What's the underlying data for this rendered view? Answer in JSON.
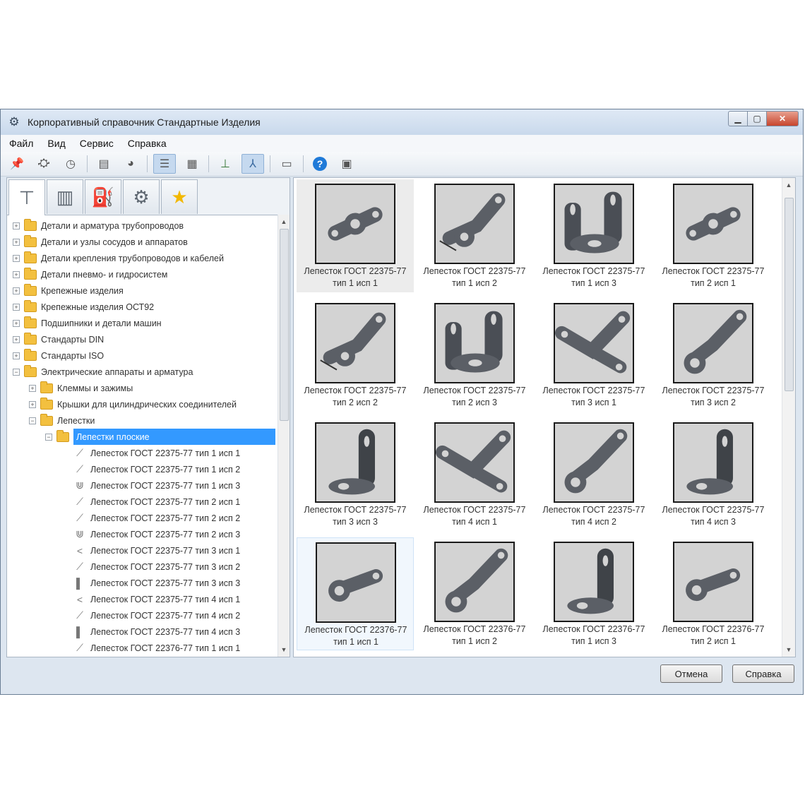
{
  "window": {
    "title": "Корпоративный справочник Стандартные Изделия"
  },
  "menu": [
    "Файл",
    "Вид",
    "Сервис",
    "Справка"
  ],
  "tree": {
    "folders": [
      "Детали и арматура трубопроводов",
      "Детали и узлы сосудов и аппаратов",
      "Детали крепления трубопроводов и кабелей",
      "Детали пневмо- и гидросистем",
      "Крепежные изделия",
      "Крепежные изделия ОСТ92",
      "Подшипники и детали машин",
      "Стандарты DIN",
      "Стандарты ISO",
      "Электрические аппараты и арматура"
    ],
    "sub_folders": [
      "Клеммы и зажимы",
      "Крышки для цилиндрических соединителей",
      "Лепестки"
    ],
    "selected_folder": "Лепестки плоские",
    "leaves": [
      "Лепесток ГОСТ 22375-77 тип 1 исп 1",
      "Лепесток ГОСТ 22375-77 тип 1 исп 2",
      "Лепесток ГОСТ 22375-77 тип 1 исп 3",
      "Лепесток ГОСТ 22375-77 тип 2 исп 1",
      "Лепесток ГОСТ 22375-77 тип 2 исп 2",
      "Лепесток ГОСТ 22375-77 тип 2 исп 3",
      "Лепесток ГОСТ 22375-77 тип 3 исп 1",
      "Лепесток ГОСТ 22375-77 тип 3 исп 2",
      "Лепесток ГОСТ 22375-77 тип 3 исп 3",
      "Лепесток ГОСТ 22375-77 тип 4 исп 1",
      "Лепесток ГОСТ 22375-77 тип 4 исп 2",
      "Лепесток ГОСТ 22375-77 тип 4 исп 3",
      "Лепесток ГОСТ 22376-77 тип 1 исп 1"
    ]
  },
  "grid": [
    {
      "line1": "Лепесток ГОСТ 22375-77",
      "line2": "тип 1 исп 1",
      "shape": "flat"
    },
    {
      "line1": "Лепесток ГОСТ 22375-77",
      "line2": "тип 1 исп 2",
      "shape": "bent"
    },
    {
      "line1": "Лепесток ГОСТ 22375-77",
      "line2": "тип 1 исп 3",
      "shape": "bracket"
    },
    {
      "line1": "Лепесток ГОСТ 22375-77",
      "line2": "тип 2 исп 1",
      "shape": "flat"
    },
    {
      "line1": "Лепесток ГОСТ 22375-77",
      "line2": "тип 2 исп 2",
      "shape": "bent"
    },
    {
      "line1": "Лепесток ГОСТ 22375-77",
      "line2": "тип 2 исп 3",
      "shape": "bracket"
    },
    {
      "line1": "Лепесток ГОСТ 22375-77",
      "line2": "тип 3 исп 1",
      "shape": "vee"
    },
    {
      "line1": "Лепесток ГОСТ 22375-77",
      "line2": "тип 3 исп 2",
      "shape": "bent2"
    },
    {
      "line1": "Лепесток ГОСТ 22375-77",
      "line2": "тип 3 исп 3",
      "shape": "upright"
    },
    {
      "line1": "Лепесток ГОСТ 22375-77",
      "line2": "тип 4 исп 1",
      "shape": "vee"
    },
    {
      "line1": "Лепесток ГОСТ 22375-77",
      "line2": "тип 4 исп 2",
      "shape": "bent2"
    },
    {
      "line1": "Лепесток ГОСТ 22375-77",
      "line2": "тип 4 исп 3",
      "shape": "upright"
    },
    {
      "line1": "Лепесток ГОСТ 22376-77",
      "line2": "тип 1 исп 1",
      "shape": "flat2"
    },
    {
      "line1": "Лепесток ГОСТ 22376-77",
      "line2": "тип 1 исп 2",
      "shape": "bent2"
    },
    {
      "line1": "Лепесток ГОСТ 22376-77",
      "line2": "тип 1 исп 3",
      "shape": "upright"
    },
    {
      "line1": "Лепесток ГОСТ 22376-77",
      "line2": "тип 2 исп 1",
      "shape": "flat2"
    }
  ],
  "buttons": {
    "cancel": "Отмена",
    "help": "Справка"
  },
  "colors": {
    "selection": "#3399ff",
    "folder": "#f3c03f",
    "part": "#5b5f66"
  },
  "icons": {
    "app": "gear-icon",
    "toolbar": [
      "pin-icon",
      "binoculars-icon",
      "clock-icon",
      "save-icon",
      "sync-icon",
      "list-view-icon",
      "table-view-icon",
      "axis-2d-icon",
      "axis-3d-icon",
      "window-icon",
      "help-icon",
      "info-icon"
    ],
    "tabs": [
      "bolt-icon",
      "book-icon",
      "fitting-icon",
      "gear-icon",
      "star-icon"
    ]
  }
}
